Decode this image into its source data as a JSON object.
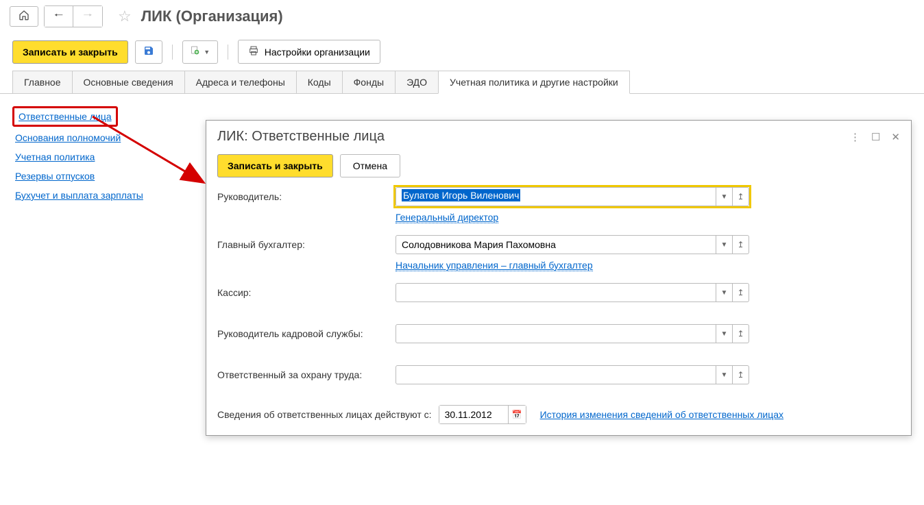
{
  "header": {
    "title": "ЛИК (Организация)"
  },
  "toolbar": {
    "save_close": "Записать и закрыть",
    "org_settings": "Настройки организации"
  },
  "tabs": [
    {
      "label": "Главное"
    },
    {
      "label": "Основные сведения"
    },
    {
      "label": "Адреса и телефоны"
    },
    {
      "label": "Коды"
    },
    {
      "label": "Фонды"
    },
    {
      "label": "ЭДО"
    },
    {
      "label": "Учетная политика и другие настройки"
    }
  ],
  "sidebar": {
    "items": [
      {
        "label": "Ответственные лица"
      },
      {
        "label": "Основания полномочий"
      },
      {
        "label": "Учетная политика"
      },
      {
        "label": "Резервы отпусков"
      },
      {
        "label": "Бухучет и выплата зарплаты"
      }
    ]
  },
  "panel": {
    "title": "ЛИК: Ответственные лица",
    "save_close": "Записать и закрыть",
    "cancel": "Отмена",
    "fields": {
      "director": {
        "label": "Руководитель:",
        "value": "Булатов Игорь Виленович",
        "position": "Генеральный директор "
      },
      "accountant": {
        "label": "Главный бухгалтер:",
        "value": "Солодовникова Мария Пахомовна",
        "position": "Начальник управления – главный бухгалтер "
      },
      "cashier": {
        "label": "Кассир:",
        "value": ""
      },
      "hr": {
        "label": "Руководитель кадровой службы:",
        "value": ""
      },
      "safety": {
        "label": "Ответственный за охрану труда:",
        "value": ""
      }
    },
    "footer": {
      "label": "Сведения об ответственных лицах действуют с:",
      "date": "30.11.2012",
      "history_link": "История изменения сведений об ответственных лицах"
    }
  }
}
